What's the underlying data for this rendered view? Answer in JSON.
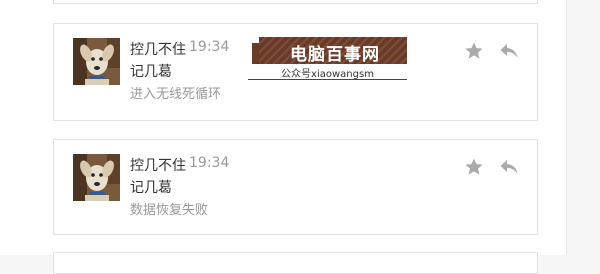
{
  "messages": [
    {
      "sender": "控几不住",
      "time": "19:34",
      "subject": "记几葛",
      "preview": "进入无线死循环"
    },
    {
      "sender": "控几不住",
      "time": "19:34",
      "subject": "记几葛",
      "preview": "数据恢复失败"
    }
  ],
  "actions": {
    "star_icon": "star-icon",
    "reply_icon": "reply-icon",
    "icon_color": "#aaaaaa"
  },
  "watermark": {
    "title": "电脑百事网",
    "subtitle": "公众号xiaowangsm",
    "color": "#6b3a26"
  }
}
